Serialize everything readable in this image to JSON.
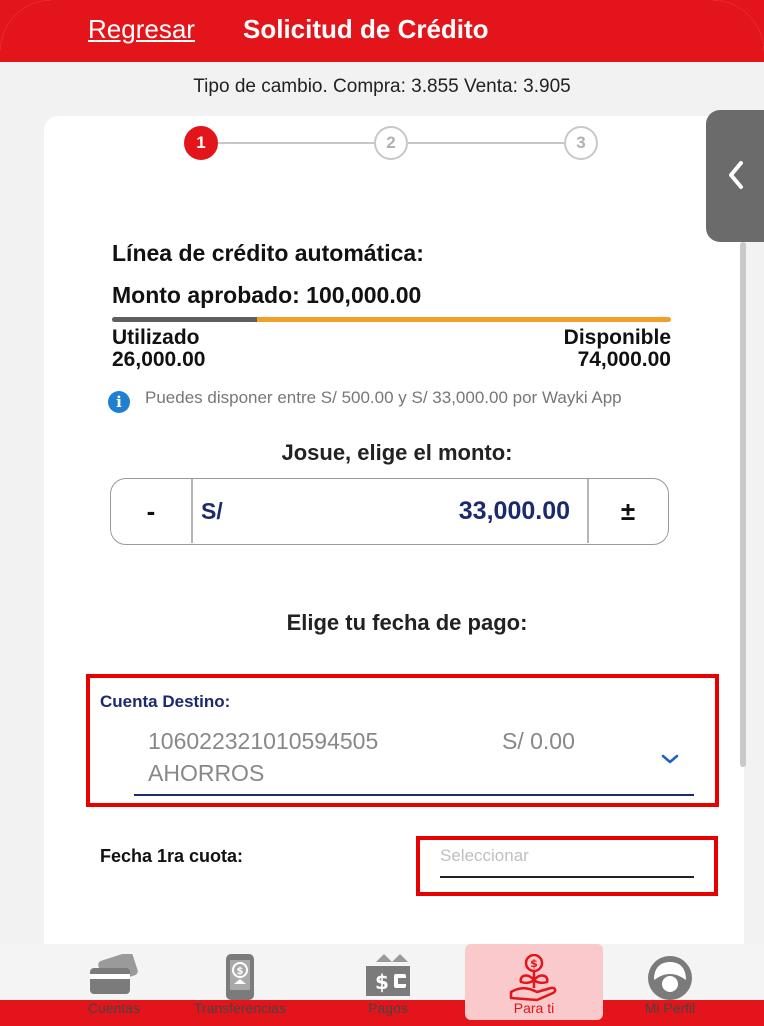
{
  "header": {
    "back_label": "Regresar",
    "title": "Solicitud de Crédito"
  },
  "exchange_rate": "Tipo de cambio. Compra: 3.855 Venta: 3.905",
  "steps": [
    {
      "label": "1",
      "state": "active"
    },
    {
      "label": "2",
      "state": "inactive"
    },
    {
      "label": "3",
      "state": "inactive"
    }
  ],
  "credit": {
    "line_title": "Línea de crédito automática:",
    "approved": "Monto aprobado: 100,000.00",
    "used_label": "Utilizado",
    "used_value": "26,000.00",
    "available_label": "Disponible",
    "available_value": "74,000.00",
    "used_fraction": 0.26,
    "info_text": "Puedes disponer entre S/ 500.00 y S/ 33,000.00 por Wayki App"
  },
  "amount": {
    "prompt": "Josue, elige el monto:",
    "minus": "-",
    "currency": "S/",
    "value": "33,000.00",
    "plus": "±"
  },
  "payment_date_title": "Elige tu fecha de pago:",
  "destination": {
    "label": "Cuenta Destino:",
    "account": "106022321010594505",
    "balance": "S/ 0.00",
    "type": "AHORROS"
  },
  "first_installment": {
    "label": "Fecha 1ra cuota:",
    "placeholder": "Seleccionar"
  },
  "nav": [
    {
      "label": "Cuentas",
      "icon": "cards-icon"
    },
    {
      "label": "Transferencias",
      "icon": "phone-transfer-icon"
    },
    {
      "label": "Pagos",
      "icon": "payments-icon"
    },
    {
      "label": "Para ti",
      "icon": "plant-money-icon"
    },
    {
      "label": "Mi Perfil",
      "icon": "profile-icon"
    }
  ],
  "colors": {
    "brand_red": "#e3151b",
    "navy": "#1b2a6b",
    "progress_available": "#f0a026",
    "progress_used": "#5e5e5e",
    "highlight": "#e80000"
  }
}
